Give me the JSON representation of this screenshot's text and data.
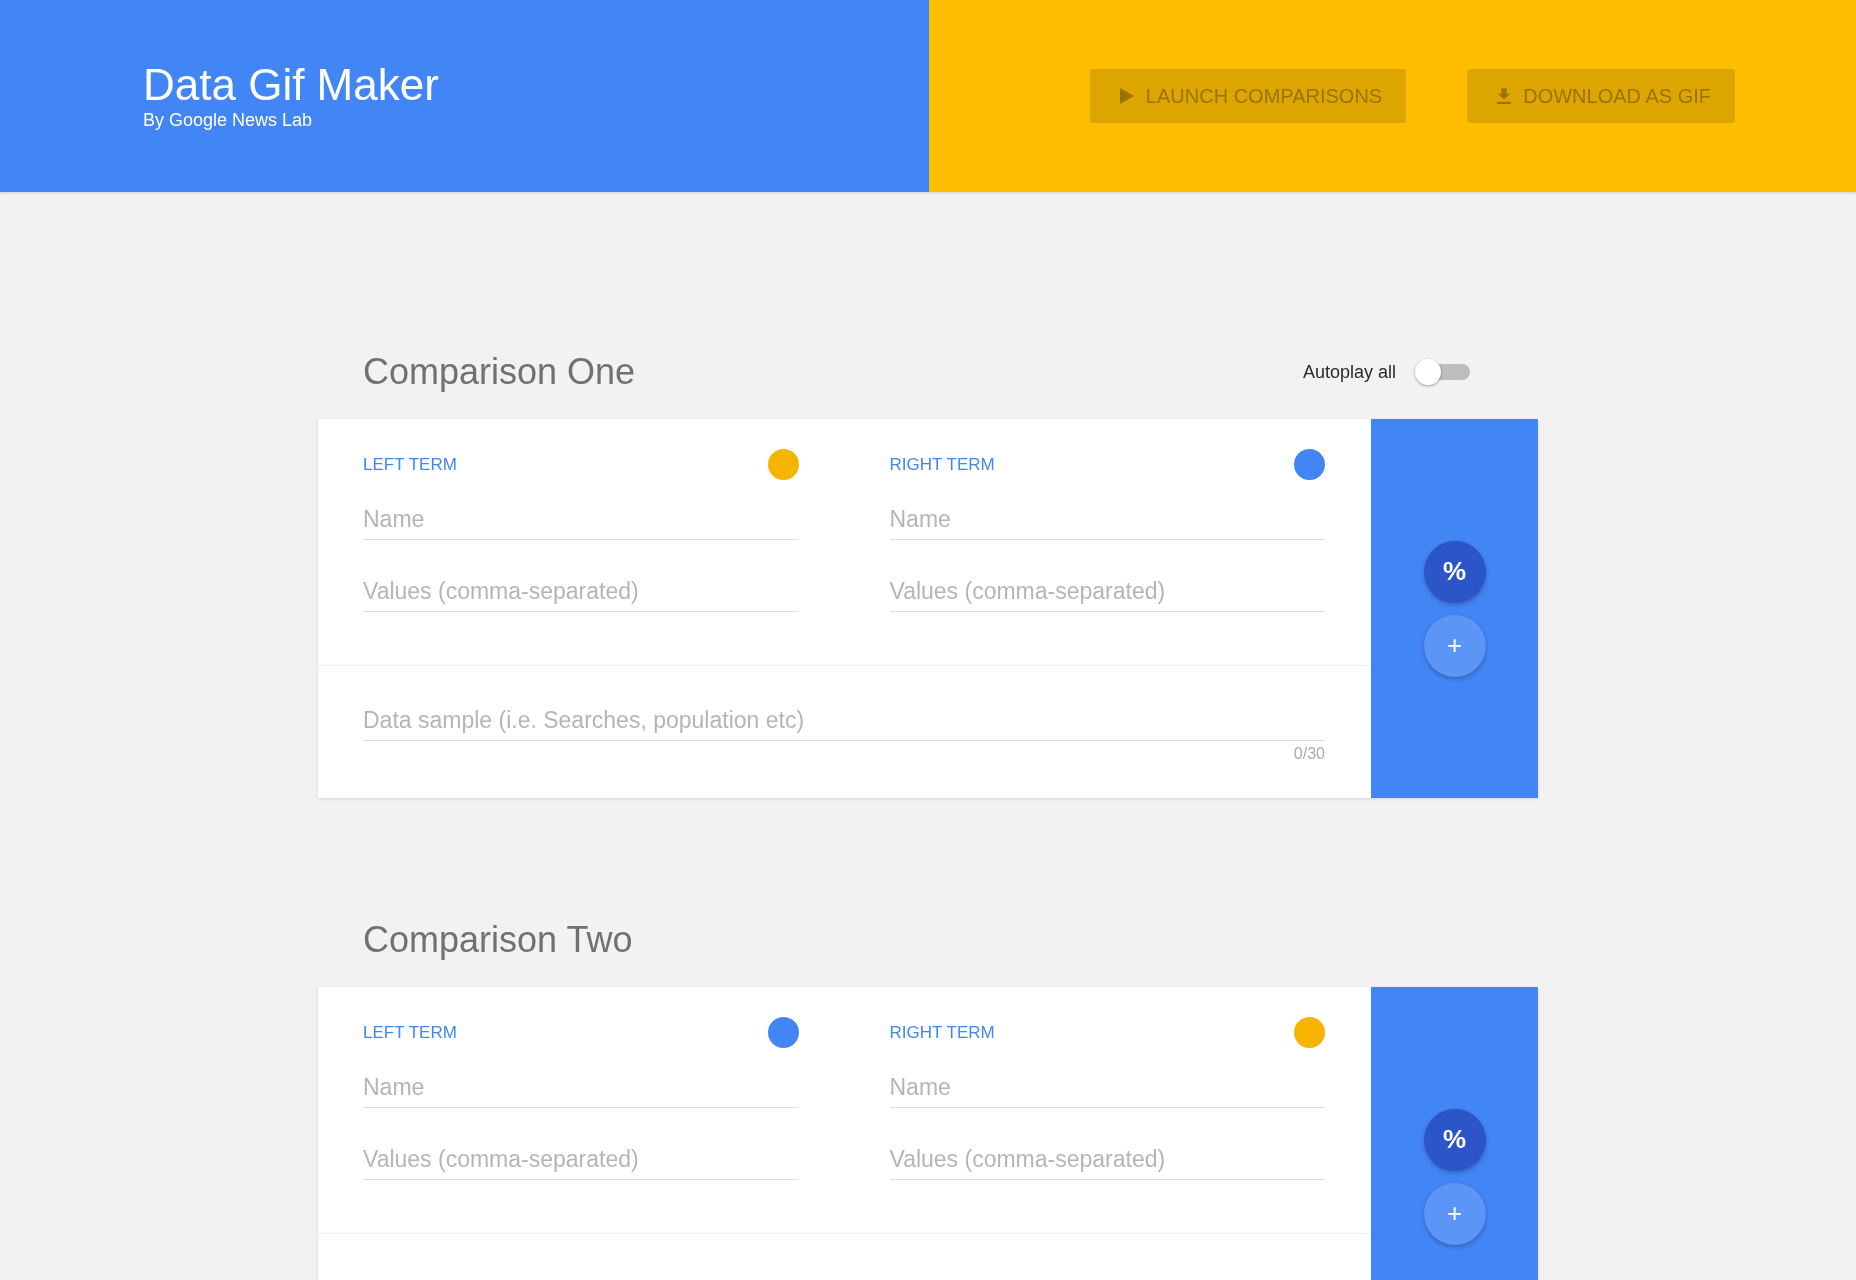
{
  "header": {
    "title": "Data Gif Maker",
    "subtitle": "By Google News Lab",
    "buttons": [
      {
        "label": "LAUNCH COMPARISONS",
        "kind": "play"
      },
      {
        "label": "DOWNLOAD AS GIF",
        "kind": "download"
      }
    ]
  },
  "comparisons": [
    {
      "title": "Comparison One",
      "autoplay": {
        "label": "Autoplay all",
        "on": false
      },
      "terms": [
        {
          "label": "LEFT TERM",
          "color": "#f4b400",
          "fields": [
            {
              "placeholder": "Name"
            },
            {
              "placeholder": "Values (comma-separated)"
            }
          ]
        },
        {
          "label": "RIGHT TERM",
          "color": "#4285f4",
          "fields": [
            {
              "placeholder": "Name"
            },
            {
              "placeholder": "Values (comma-separated)"
            }
          ]
        }
      ],
      "sample": {
        "placeholder": "Data sample (i.e. Searches, population etc)",
        "counter": "0/30"
      },
      "actions": [
        {
          "label": "%",
          "kind": "percent"
        },
        {
          "label": "+",
          "kind": "add"
        }
      ]
    },
    {
      "title": "Comparison Two",
      "terms": [
        {
          "label": "LEFT TERM",
          "color": "#4285f4",
          "fields": [
            {
              "placeholder": "Name"
            },
            {
              "placeholder": "Values (comma-separated)"
            }
          ]
        },
        {
          "label": "RIGHT TERM",
          "color": "#f4b400",
          "fields": [
            {
              "placeholder": "Name"
            },
            {
              "placeholder": "Values (comma-separated)"
            }
          ]
        }
      ],
      "actions": [
        {
          "label": "%",
          "kind": "percent"
        },
        {
          "label": "+",
          "kind": "add"
        }
      ]
    }
  ]
}
